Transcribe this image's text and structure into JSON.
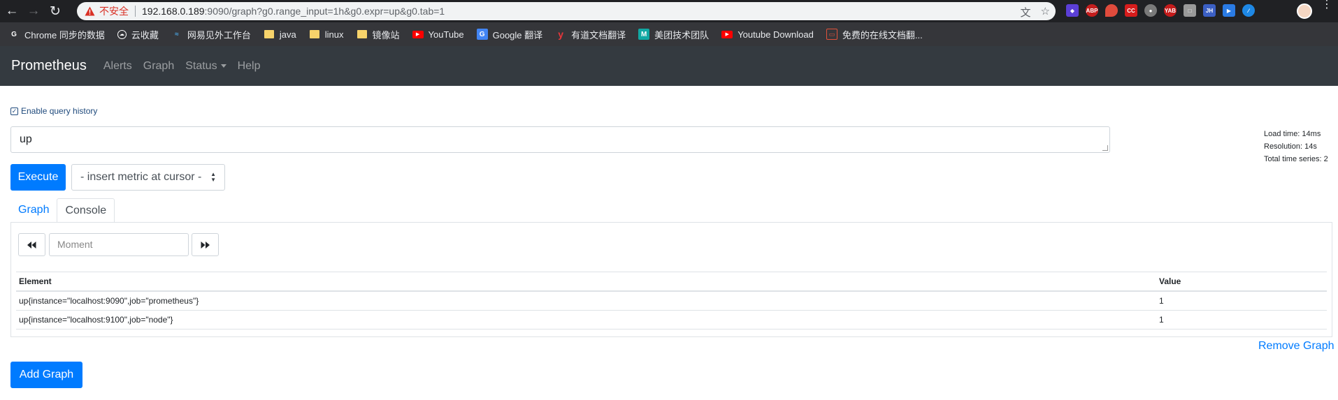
{
  "browser": {
    "security_label": "不安全",
    "url_host": "192.168.0.189",
    "url_rest": ":9090/graph?g0.range_input=1h&g0.expr=up&g0.tab=1",
    "bookmarks": [
      {
        "label": "Chrome 同步的数据",
        "icon": "google-icon"
      },
      {
        "label": "云收藏",
        "icon": "cloud-icon"
      },
      {
        "label": "网易见外工作台",
        "icon": "netease-icon"
      },
      {
        "label": "java",
        "icon": "folder-icon"
      },
      {
        "label": "linux",
        "icon": "folder-icon"
      },
      {
        "label": "镜像站",
        "icon": "folder-icon"
      },
      {
        "label": "YouTube",
        "icon": "youtube-icon"
      },
      {
        "label": "Google 翻译",
        "icon": "translate-icon"
      },
      {
        "label": "有道文档翻译",
        "icon": "youdao-icon"
      },
      {
        "label": "美团技术团队",
        "icon": "meituan-icon"
      },
      {
        "label": "Youtube Download",
        "icon": "youtube-icon"
      },
      {
        "label": "免费的在线文档翻...",
        "icon": "doc-translate-icon"
      }
    ]
  },
  "navbar": {
    "brand": "Prometheus",
    "links": [
      "Alerts",
      "Graph",
      "Status",
      "Help"
    ]
  },
  "query": {
    "history_label": "Enable query history",
    "expression": "up",
    "execute_label": "Execute",
    "metric_select": "- insert metric at cursor -"
  },
  "stats": {
    "load_time": "Load time: 14ms",
    "resolution": "Resolution: 14s",
    "total_series": "Total time series: 2"
  },
  "tabs": [
    "Graph",
    "Console"
  ],
  "console": {
    "moment_placeholder": "Moment",
    "columns": [
      "Element",
      "Value"
    ],
    "rows": [
      {
        "element": "up{instance=\"localhost:9090\",job=\"prometheus\"}",
        "value": "1"
      },
      {
        "element": "up{instance=\"localhost:9100\",job=\"node\"}",
        "value": "1"
      }
    ]
  },
  "actions": {
    "remove_graph": "Remove Graph",
    "add_graph": "Add Graph"
  },
  "colors": {
    "primary": "#007bff",
    "navbar": "#343a40",
    "chrome_toolbar": "#202124",
    "bookmark_bar": "#35363a"
  }
}
